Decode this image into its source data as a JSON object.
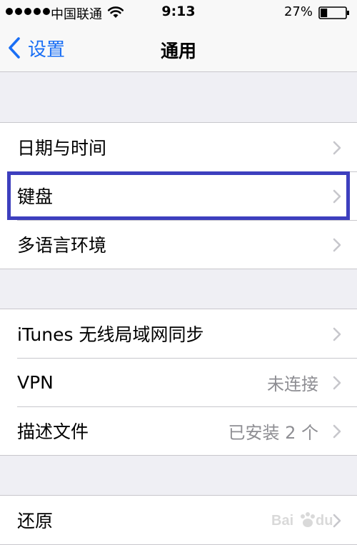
{
  "status_bar": {
    "carrier": "中国联通",
    "time": "9:13",
    "battery_percent": "27%",
    "battery_level": 0.27,
    "signal_bars": 5
  },
  "nav": {
    "back_label": "设置",
    "title": "通用"
  },
  "groups": [
    {
      "rows": [
        {
          "label": "日期与时间",
          "detail": ""
        },
        {
          "label": "键盘",
          "detail": ""
        },
        {
          "label": "多语言环境",
          "detail": ""
        }
      ]
    },
    {
      "rows": [
        {
          "label": "iTunes 无线局域网同步",
          "detail": ""
        },
        {
          "label": "VPN",
          "detail": "未连接"
        },
        {
          "label": "描述文件",
          "detail": "已安装 2 个"
        }
      ]
    },
    {
      "rows": [
        {
          "label": "还原",
          "detail": ""
        }
      ]
    }
  ],
  "colors": {
    "accent": "#1a6ff5",
    "highlight": "#3d3fbe",
    "background": "#efeff4",
    "separator": "#c8c7cc",
    "detail": "#8e8e93"
  },
  "icons": {
    "back": "chevron-left-icon",
    "disclosure": "chevron-right-icon",
    "wifi": "wifi-icon",
    "battery": "battery-icon"
  }
}
